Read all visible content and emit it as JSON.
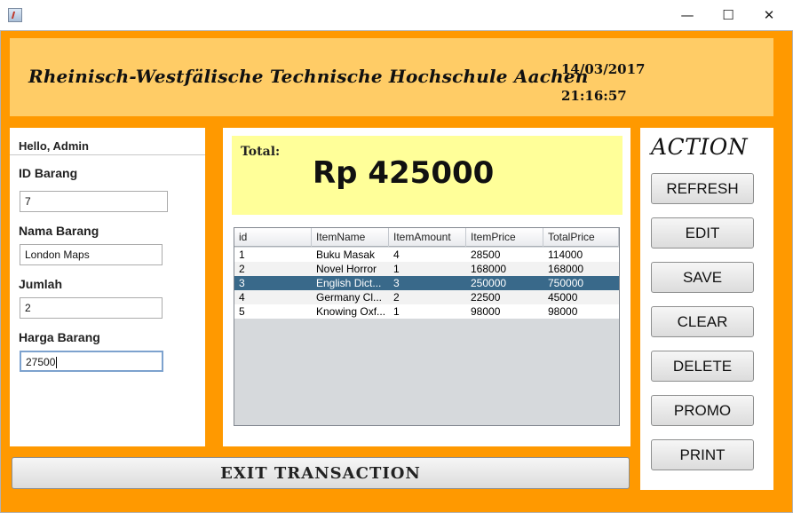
{
  "window": {
    "minimize_glyph": "—",
    "maximize_glyph": "☐",
    "close_glyph": "✕"
  },
  "header": {
    "university": "Rheinisch-Westfälische Technische Hochschule Aachen",
    "date": "14/03/2017",
    "time": "21:16:57",
    "background": "#ffcc66"
  },
  "colors": {
    "frame": "#ff9900",
    "total_box": "#ffff99",
    "selected_row": "#39698a"
  },
  "form": {
    "greeting": "Hello, Admin",
    "id_label": "ID Barang",
    "id_value": "7",
    "name_label": "Nama Barang",
    "name_value": "London Maps",
    "qty_label": "Jumlah",
    "qty_value": "2",
    "price_label": "Harga Barang",
    "price_value": "27500"
  },
  "total": {
    "label": "Total:",
    "value": "Rp 425000"
  },
  "table": {
    "columns": [
      "id",
      "ItemName",
      "ItemAmount",
      "ItemPrice",
      "TotalPrice"
    ],
    "rows": [
      [
        "1",
        "Buku Masak",
        "4",
        "28500",
        "114000"
      ],
      [
        "2",
        "Novel Horror",
        "1",
        "168000",
        "168000"
      ],
      [
        "3",
        "English Dict...",
        "3",
        "250000",
        "750000"
      ],
      [
        "4",
        "Germany Cl...",
        "2",
        "22500",
        "45000"
      ],
      [
        "5",
        "Knowing Oxf...",
        "1",
        "98000",
        "98000"
      ]
    ],
    "selected_row": 2
  },
  "actions": {
    "title": "ACTION",
    "refresh": "REFRESH",
    "edit": "EDIT",
    "save": "SAVE",
    "clear": "CLEAR",
    "delete": "DELETE",
    "promo": "PROMO",
    "print": "PRINT"
  },
  "exit_label": "EXIT TRANSACTION"
}
